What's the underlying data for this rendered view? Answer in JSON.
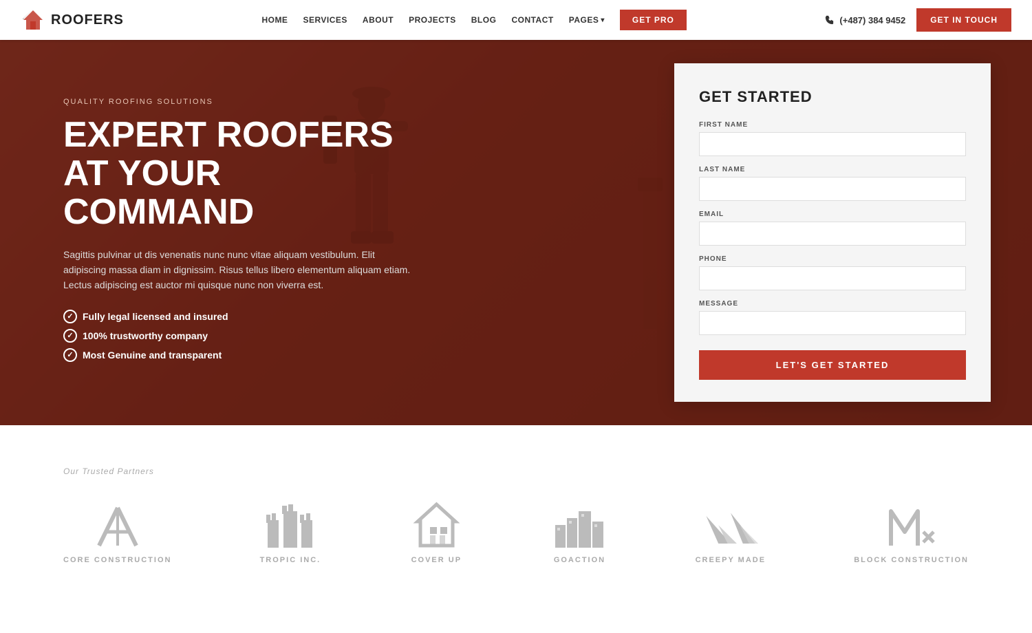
{
  "nav": {
    "logo_text": "ROOFERS",
    "links": [
      {
        "label": "HOME",
        "id": "home"
      },
      {
        "label": "SERVICES",
        "id": "services"
      },
      {
        "label": "ABOUT",
        "id": "about"
      },
      {
        "label": "PROJECTS",
        "id": "projects"
      },
      {
        "label": "BLOG",
        "id": "blog"
      },
      {
        "label": "CONTACT",
        "id": "contact"
      },
      {
        "label": "PAGES",
        "id": "pages"
      }
    ],
    "get_pro_label": "GET PRO",
    "phone": "(+487) 384 9452",
    "get_touch_label": "GET IN TOUCH"
  },
  "hero": {
    "subtitle": "QUALITY ROOFING SOLUTIONS",
    "title_line1": "EXPERT ROOFERS AT YOUR",
    "title_line2": "COMMAND",
    "description": "Sagittis pulvinar ut dis venenatis nunc nunc vitae aliquam vestibulum. Elit adipiscing massa diam in dignissim. Risus tellus libero elementum aliquam etiam. Lectus adipiscing est auctor mi quisque nunc non viverra est.",
    "features": [
      "Fully legal licensed and insured",
      "100% trustworthy company",
      "Most Genuine and transparent"
    ]
  },
  "form": {
    "title": "GET STARTED",
    "first_name_label": "FIRST NAME",
    "last_name_label": "LAST NAME",
    "email_label": "EMAIL",
    "phone_label": "PHONE",
    "message_label": "MESSAGE",
    "submit_label": "LET'S GET STARTED"
  },
  "partners": {
    "label": "Our Trusted Partners",
    "items": [
      {
        "name": "CORE CONSTRUCTION",
        "id": "core"
      },
      {
        "name": "TROPIC INC.",
        "id": "tropic"
      },
      {
        "name": "COVER UP",
        "id": "coverup"
      },
      {
        "name": "GOACTION",
        "id": "goaction"
      },
      {
        "name": "CREEPY MADE",
        "id": "creepymade"
      },
      {
        "name": "Block Construction",
        "id": "block"
      }
    ]
  },
  "colors": {
    "brand_red": "#c0392b",
    "text_dark": "#222222",
    "text_light": "#aaaaaa"
  }
}
